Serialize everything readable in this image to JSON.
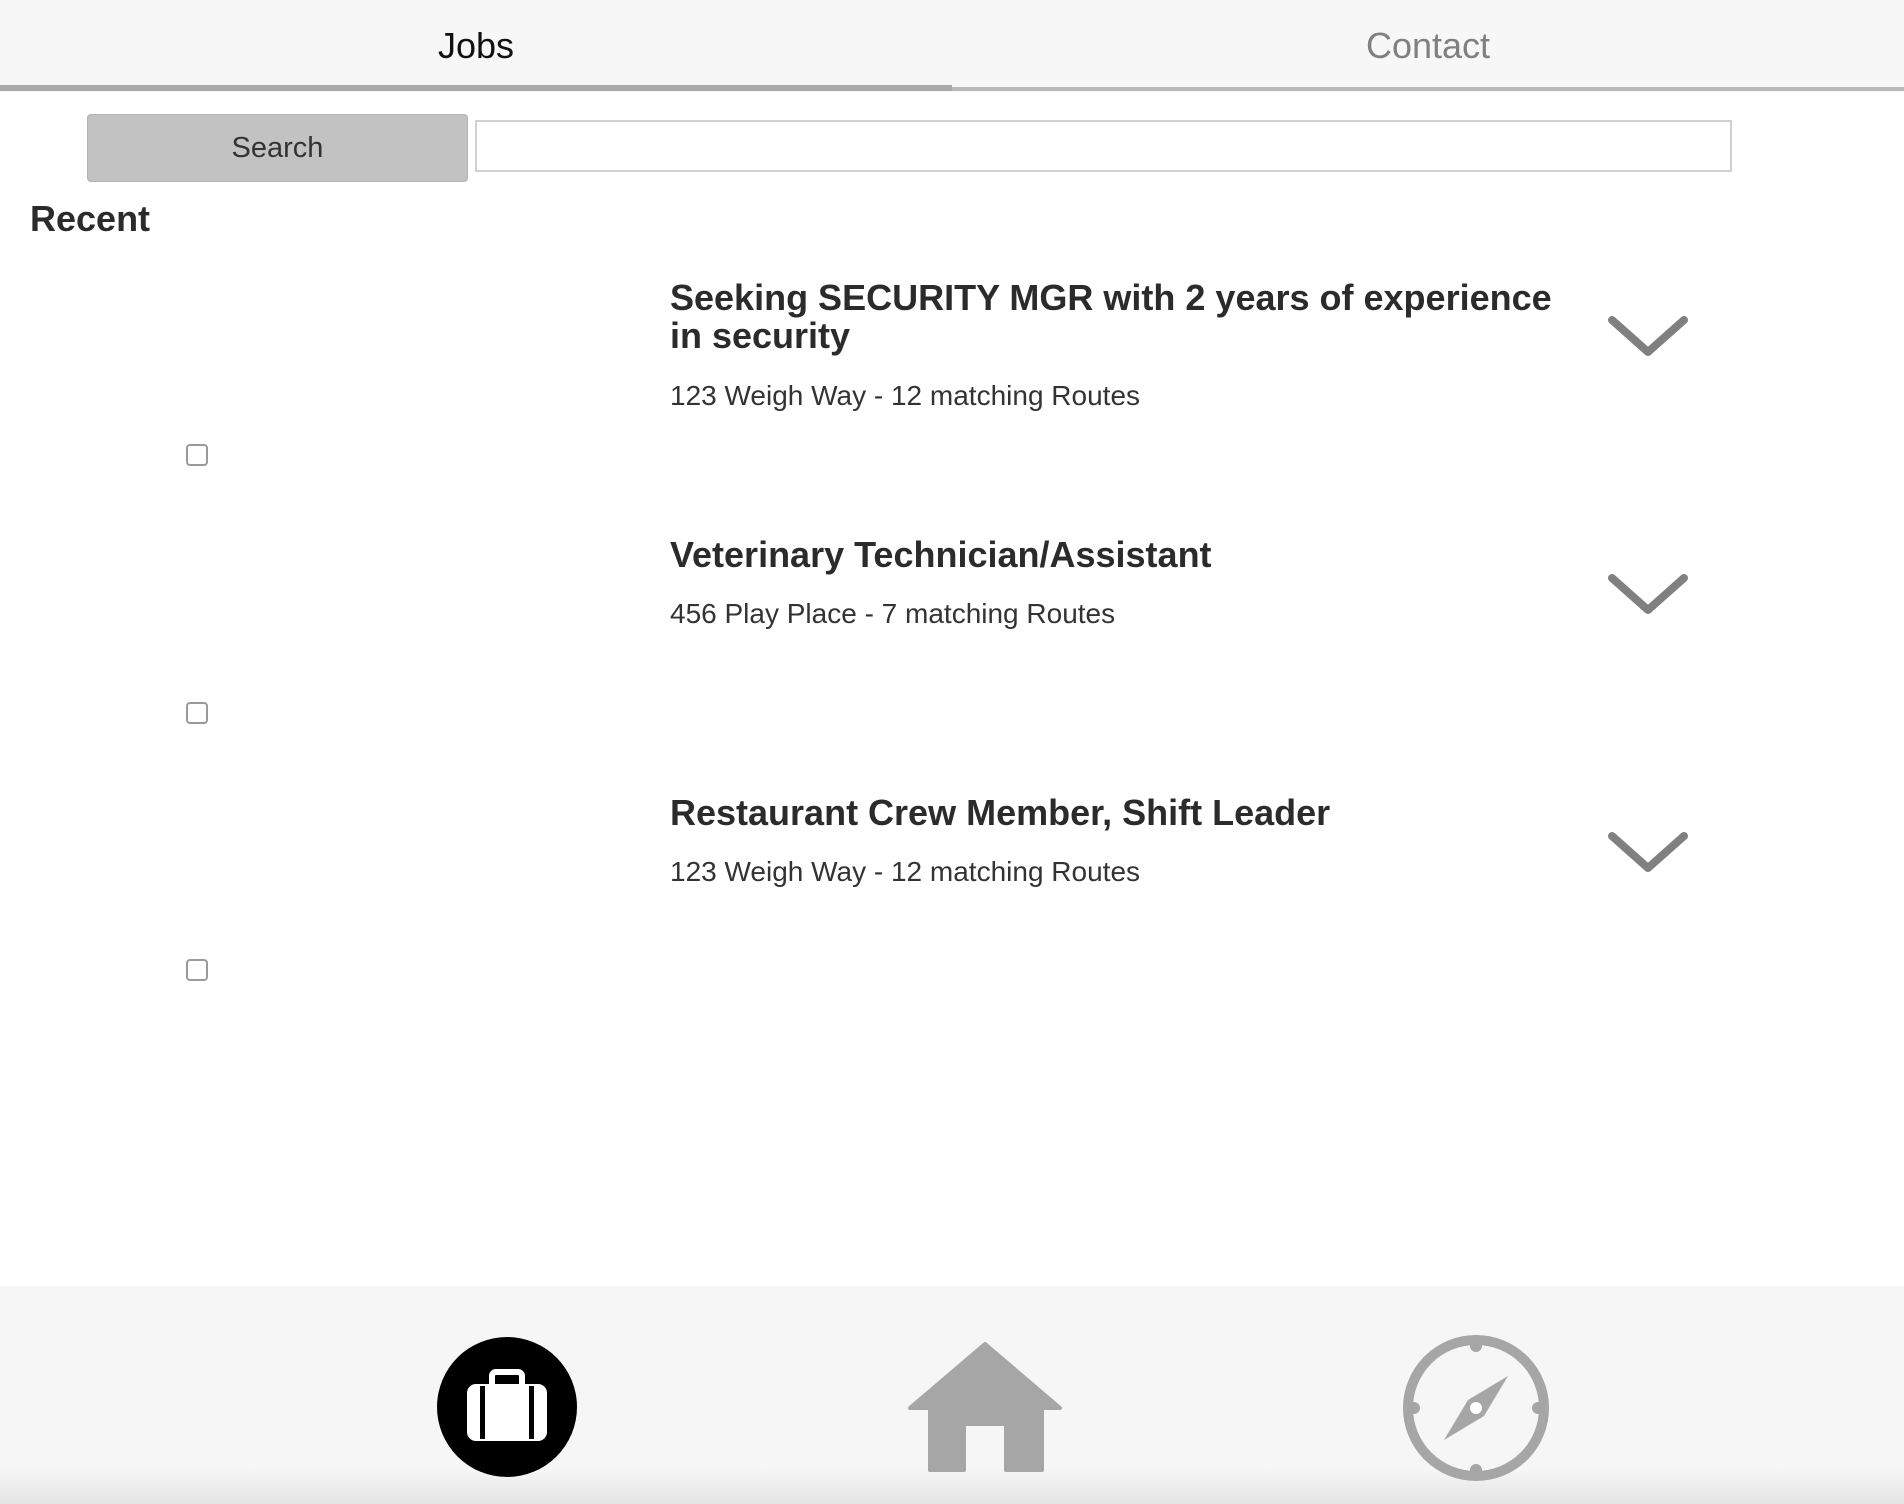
{
  "tabs": {
    "jobs_label": "Jobs",
    "contact_label": "Contact"
  },
  "search": {
    "button_label": "Search",
    "input_value": "",
    "input_placeholder": ""
  },
  "recent_heading": "Recent",
  "jobs": [
    {
      "title": "Seeking SECURITY MGR with 2 years of experience in security",
      "subtitle": "123 Weigh Way - 12 matching Routes",
      "checked": false
    },
    {
      "title": "Veterinary Technician/Assistant",
      "subtitle": "456 Play Place - 7 matching Routes",
      "checked": false
    },
    {
      "title": "Restaurant Crew Member, Shift Leader",
      "subtitle": "123 Weigh Way - 12 matching Routes",
      "checked": false
    }
  ],
  "bottom_nav": {
    "items": [
      {
        "icon": "briefcase-icon",
        "active": true
      },
      {
        "icon": "home-icon",
        "active": false
      },
      {
        "icon": "compass-icon",
        "active": false
      }
    ],
    "active_color": "#000000",
    "inactive_color": "#a6a6a6"
  },
  "colors": {
    "tab_bar_bg": "#f7f7f7",
    "search_button_bg": "#c2c2c2",
    "chevron": "#808080",
    "text": "#333333"
  }
}
